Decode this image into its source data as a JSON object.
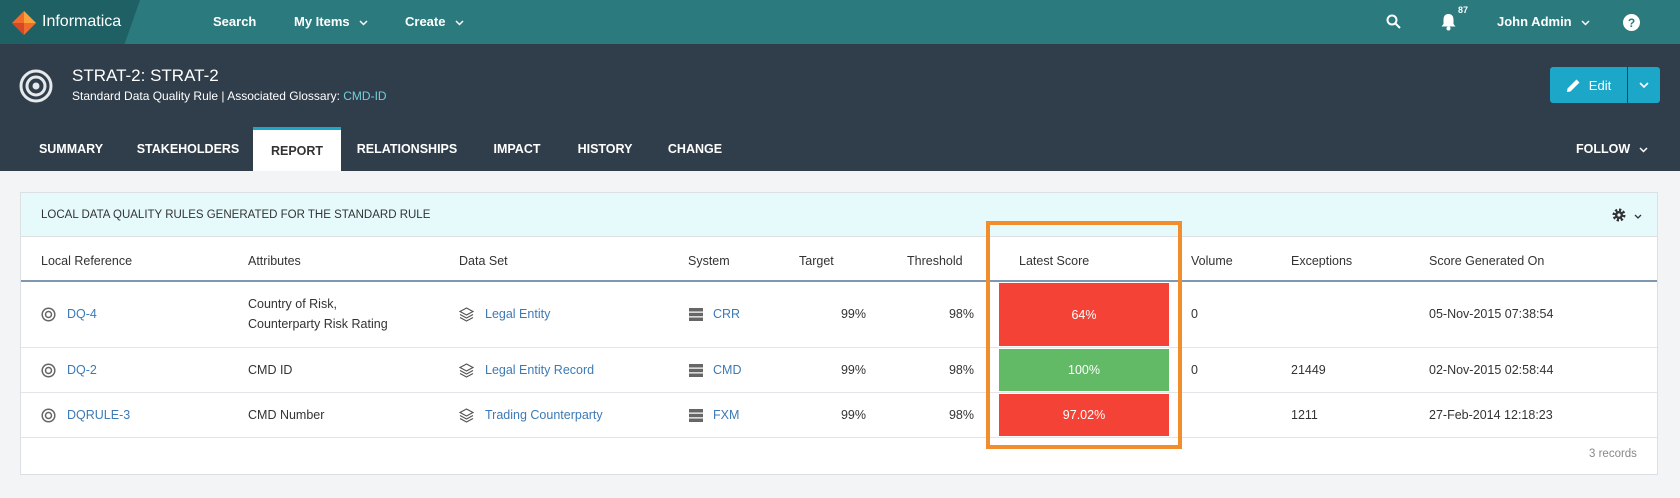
{
  "topbar": {
    "brand": "Informatica",
    "nav": [
      "Search",
      "My Items",
      "Create"
    ],
    "notifications_count": "87",
    "user": "John Admin",
    "help": "?"
  },
  "header": {
    "title": "STRAT-2: STRAT-2",
    "subtitle_prefix": "Standard Data Quality Rule | Associated Glossary: ",
    "subtitle_link": "CMD-ID",
    "edit_label": "Edit",
    "tabs": [
      "SUMMARY",
      "STAKEHOLDERS",
      "REPORT",
      "RELATIONSHIPS",
      "IMPACT",
      "HISTORY",
      "CHANGE"
    ],
    "active_tab": "REPORT",
    "follow_label": "FOLLOW"
  },
  "panel": {
    "title": "LOCAL DATA QUALITY RULES GENERATED FOR THE STANDARD RULE",
    "columns": [
      "Local Reference",
      "Attributes",
      "Data Set",
      "System",
      "Target",
      "Threshold",
      "Latest Score",
      "Volume",
      "Exceptions",
      "Score Generated On"
    ],
    "rows": [
      {
        "ref": "DQ-4",
        "attr1": "Country of Risk,",
        "attr2": "Counterparty Risk Rating",
        "dataset": "Legal Entity",
        "system": "CRR",
        "target": "99%",
        "threshold": "98%",
        "score": "64%",
        "volume": "0",
        "exceptions": "",
        "generated": "05-Nov-2015 07:38:54"
      },
      {
        "ref": "DQ-2",
        "attr1": "CMD ID",
        "attr2": "",
        "dataset": "Legal Entity Record",
        "system": "CMD",
        "target": "99%",
        "threshold": "98%",
        "score": "100%",
        "volume": "0",
        "exceptions": "21449",
        "generated": "02-Nov-2015 02:58:44"
      },
      {
        "ref": "DQRULE-3",
        "attr1": "CMD Number",
        "attr2": "",
        "dataset": "Trading Counterparty",
        "system": "FXM",
        "target": "99%",
        "threshold": "98%",
        "score": "97.02%",
        "volume": "",
        "exceptions": "1211",
        "generated": "27-Feb-2014 12:18:23"
      }
    ],
    "records_label": "3 records"
  },
  "colors": {
    "topbar": "#2b7a7e",
    "header": "#303d4a",
    "accent": "#1ca6c8",
    "score_fail": "#f44336",
    "score_pass": "#62b966",
    "highlight": "#f28d2b"
  }
}
